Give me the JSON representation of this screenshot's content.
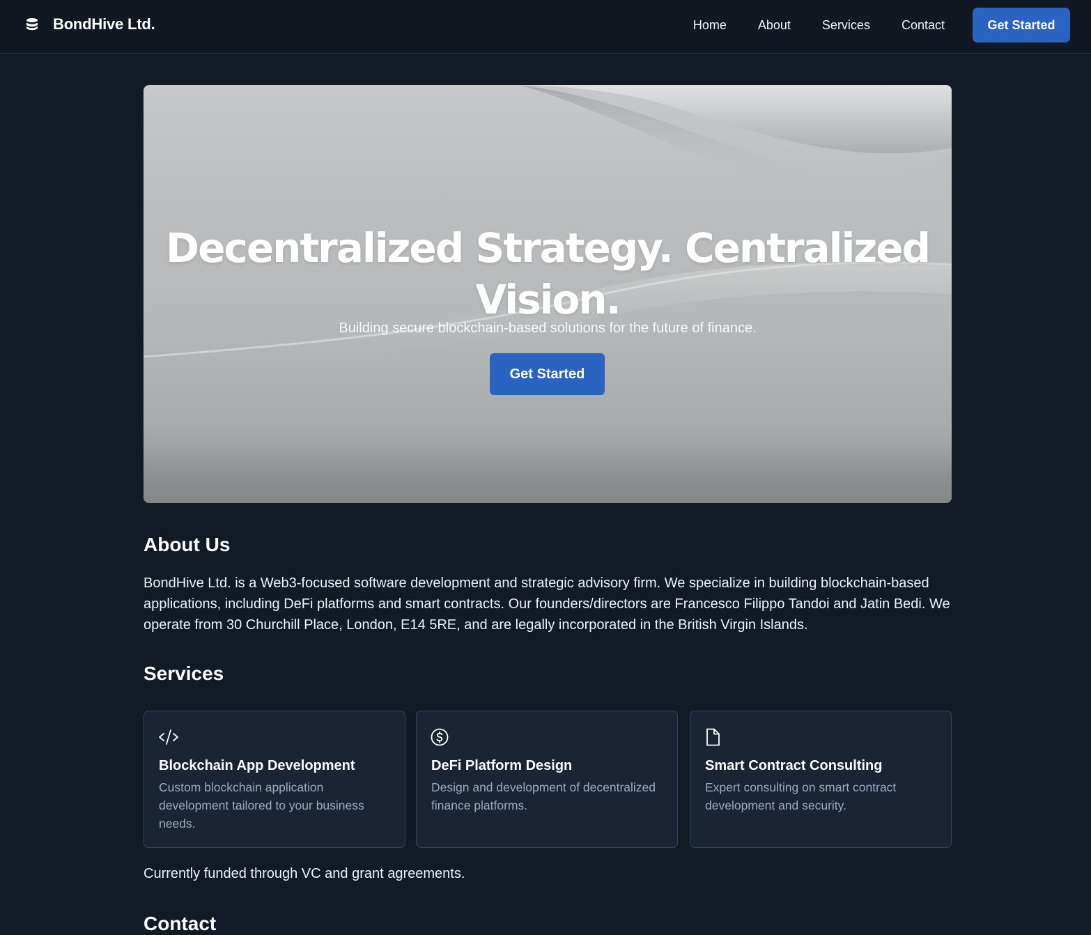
{
  "header": {
    "brand_name": "BondHive Ltd.",
    "brand_icon": "database-stack-icon",
    "nav": [
      {
        "label": "Home"
      },
      {
        "label": "About"
      },
      {
        "label": "Services"
      },
      {
        "label": "Contact"
      }
    ],
    "cta_label": "Get Started"
  },
  "hero": {
    "title": "Decentralized Strategy. Centralized Vision.",
    "subtitle": "Building secure blockchain-based solutions for the future of finance.",
    "cta_label": "Get Started"
  },
  "about": {
    "title": "About Us",
    "text": "BondHive Ltd. is a Web3-focused software development and strategic advisory firm. We specialize in building blockchain-based applications, including DeFi platforms and smart contracts. Our founders/directors are Francesco Filippo Tandoi and Jatin Bedi. We operate from 30 Churchill Place, London, E14 5RE, and are legally incorporated in the British Virgin Islands."
  },
  "services": {
    "title": "Services",
    "items": [
      {
        "icon": "code-icon",
        "title": "Blockchain App Development",
        "description": "Custom blockchain application development tailored to your business needs."
      },
      {
        "icon": "dollar-circle-icon",
        "title": "DeFi Platform Design",
        "description": "Design and development of decentralized finance platforms."
      },
      {
        "icon": "document-icon",
        "title": "Smart Contract Consulting",
        "description": "Expert consulting on smart contract development and security."
      }
    ],
    "funding_note": "Currently funded through VC and grant agreements."
  },
  "contact": {
    "title": "Contact"
  },
  "colors": {
    "page_background": "#121a25",
    "header_background": "#111821",
    "accent": "#2b63c3",
    "card_background": "#1a2433",
    "card_border": "#34445a",
    "muted_text": "#9aabbf"
  }
}
